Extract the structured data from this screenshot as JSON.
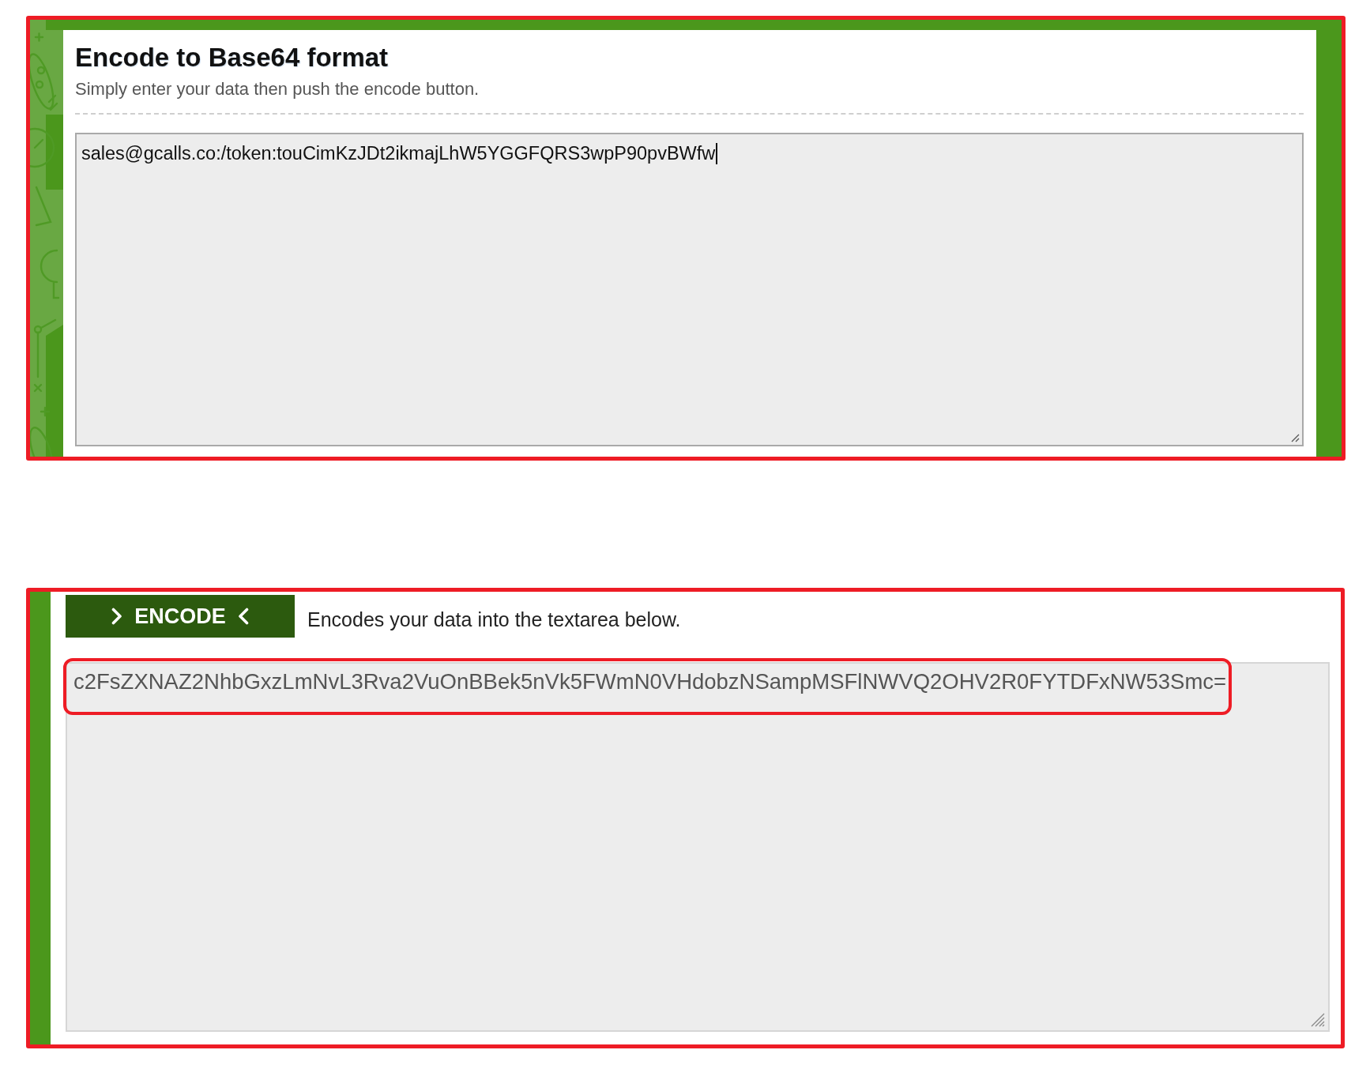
{
  "encoder": {
    "highlighted": true,
    "title": "Encode to Base64 format",
    "subtitle": "Simply enter your data then push the encode button.",
    "input": {
      "value": "sales@gcalls.co:/token:touCimKzJDt2ikmajLhW5YGGFQRS3wpP90pvBWfw",
      "focused": true
    }
  },
  "result": {
    "highlighted": true,
    "encode_button": "ENCODE",
    "description": "Encodes your data into the textarea below.",
    "output": {
      "value": "c2FsZXNAZ2NhbGxzLmNvL3Rva2VuOnBBek5nVk5FWmN0VHdobzNSampMSFlNWVQ2OHV2R0FYTDFxNW53Smc=",
      "highlighted": true
    }
  }
}
